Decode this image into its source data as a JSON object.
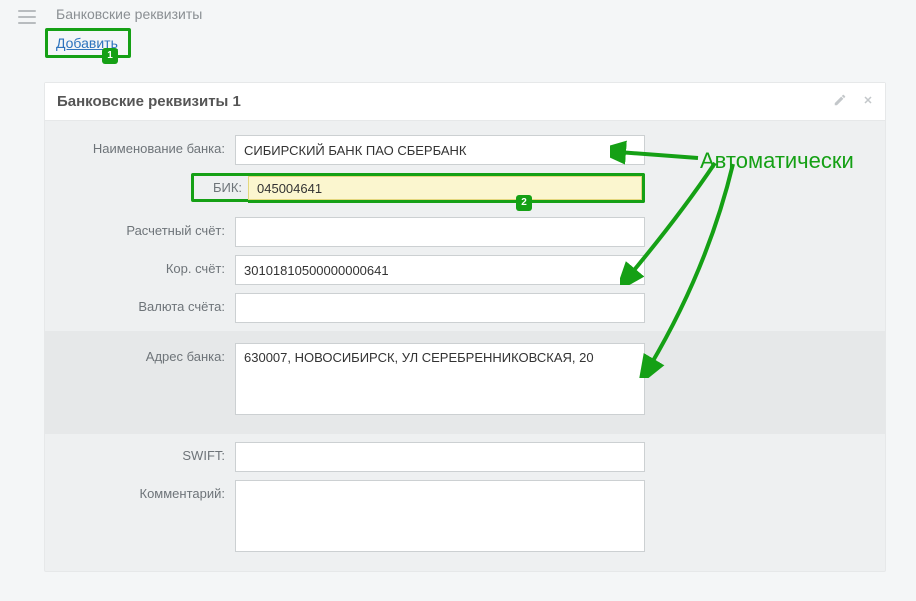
{
  "header": {
    "title": "Банковские реквизиты",
    "add_link": "Добавить",
    "badge1": "1",
    "badge2": "2"
  },
  "panel": {
    "title": "Банковские реквизиты 1"
  },
  "labels": {
    "bank_name": "Наименование банка:",
    "bik": "БИК:",
    "account": "Расчетный счёт:",
    "corr_account": "Кор. счёт:",
    "currency": "Валюта счёта:",
    "address": "Адрес банка:",
    "swift": "SWIFT:",
    "comment": "Комментарий:"
  },
  "values": {
    "bank_name": "СИБИРСКИЙ БАНК ПАО СБЕРБАНК",
    "bik": "045004641",
    "account": "",
    "corr_account": "30101810500000000641",
    "currency": "",
    "address": "630007, НОВОСИБИРСК, УЛ СЕРЕБРЕННИКОВСКАЯ, 20",
    "swift": "",
    "comment": ""
  },
  "annotation": {
    "label": "Автоматически"
  }
}
